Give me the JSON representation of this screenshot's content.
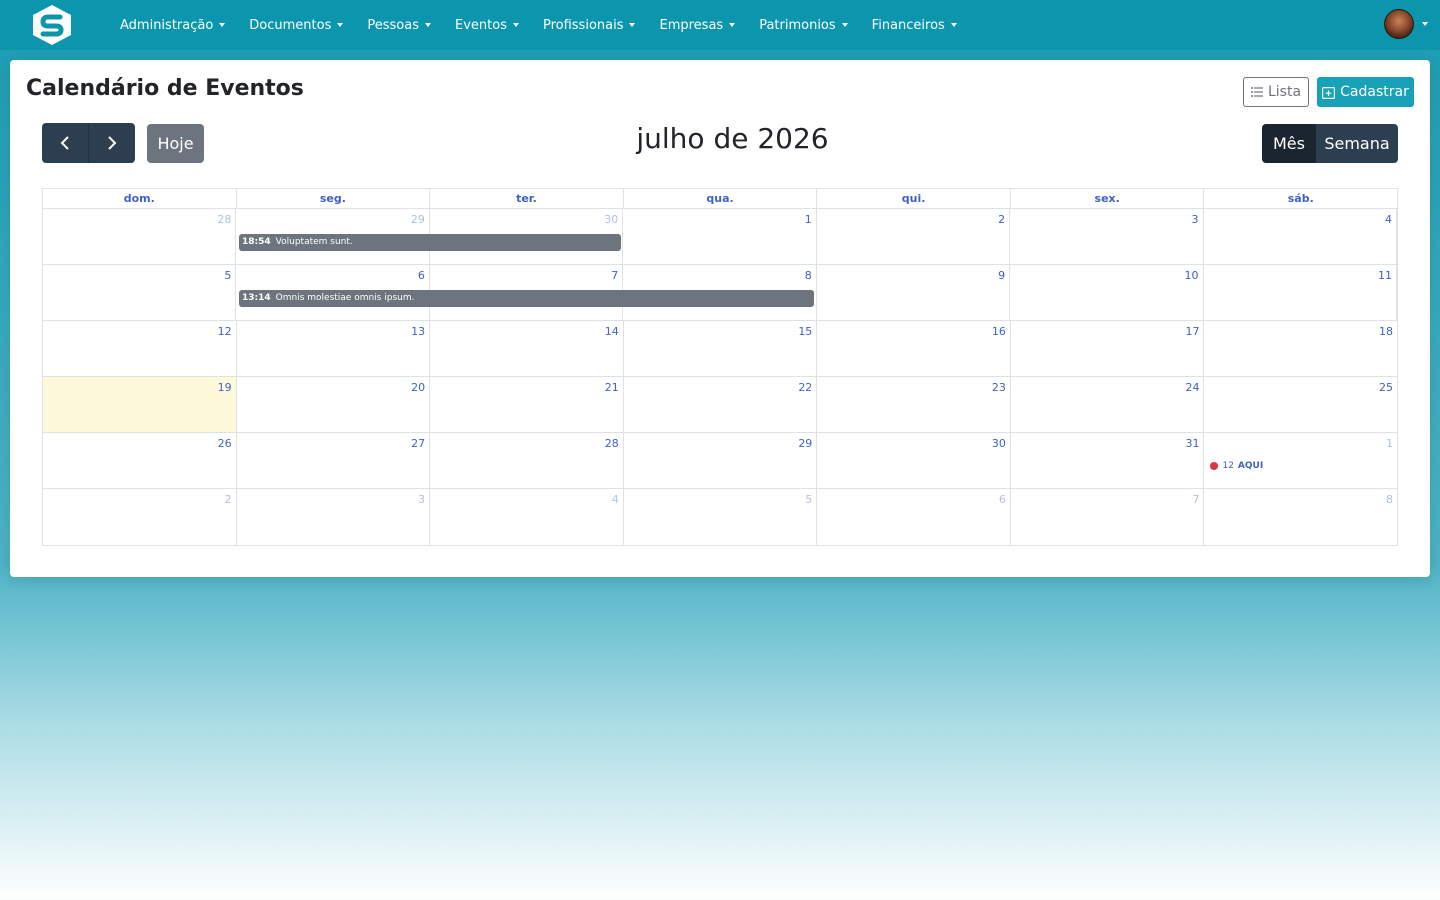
{
  "nav": {
    "menu": [
      {
        "label": "Administração"
      },
      {
        "label": "Documentos"
      },
      {
        "label": "Pessoas"
      },
      {
        "label": "Eventos"
      },
      {
        "label": "Profissionais"
      },
      {
        "label": "Empresas"
      },
      {
        "label": "Patrimonios"
      },
      {
        "label": "Financeiros"
      }
    ]
  },
  "page": {
    "title": "Calendário de Eventos",
    "lista_label": "Lista",
    "cadastrar_label": "Cadastrar"
  },
  "calendar": {
    "title": "julho de 2026",
    "today_label": "Hoje",
    "view_month": "Mês",
    "view_week": "Semana",
    "weekdays": [
      "dom.",
      "seg.",
      "ter.",
      "qua.",
      "qui.",
      "sex.",
      "sáb."
    ],
    "weeks": [
      [
        "28",
        "29",
        "30",
        "1",
        "2",
        "3",
        "4"
      ],
      [
        "5",
        "6",
        "7",
        "8",
        "9",
        "10",
        "11"
      ],
      [
        "12",
        "13",
        "14",
        "15",
        "16",
        "17",
        "18"
      ],
      [
        "19",
        "20",
        "21",
        "22",
        "23",
        "24",
        "25"
      ],
      [
        "26",
        "27",
        "28",
        "29",
        "30",
        "31",
        "1"
      ],
      [
        "2",
        "3",
        "4",
        "5",
        "6",
        "7",
        "8"
      ]
    ],
    "events": [
      {
        "time": "18:54",
        "title": "Voluptatem sunt."
      },
      {
        "time": "13:14",
        "title": "Omnis molestiae omnis ipsum."
      },
      {
        "time": "12",
        "title": "AQUI",
        "color": "#dc3545"
      }
    ]
  },
  "colors": {
    "navbar": "#0c96ae",
    "accent": "#17a2b8",
    "dark_button": "#2c3e50",
    "event": "#6c757d",
    "today_bg": "#fff9dc"
  }
}
